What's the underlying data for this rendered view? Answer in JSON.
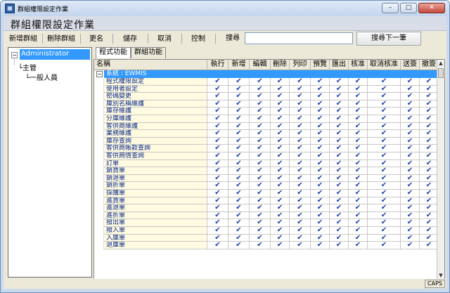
{
  "window": {
    "app_icon": "app-icon",
    "title": "群組權限設定作業",
    "buttons": {
      "minimize": "–",
      "maximize": "□",
      "close": "✕"
    }
  },
  "header": {
    "title": "群組權限設定作業"
  },
  "toolbar": {
    "new_group": "新增群組",
    "delete_group": "刪除群組",
    "rename": "更名",
    "save": "儲存",
    "cancel": "取消",
    "control": "控制",
    "search_label": "搜尋",
    "search_value": "",
    "find_next": "搜尋下一筆"
  },
  "tree": {
    "root": "Administrator",
    "root_toggle": "−",
    "children": [
      "主管",
      "一般人員"
    ]
  },
  "tabs": [
    "程式功能",
    "群組功能"
  ],
  "grid": {
    "columns": [
      "名稱",
      "執行",
      "新增",
      "編輯",
      "刪除",
      "列印",
      "預覽",
      "匯出",
      "核准",
      "取消核准",
      "送簽",
      "撤簽"
    ],
    "group_toggle": "−",
    "group_label": "系統 : EWMIS",
    "check_glyph": "✔",
    "rows": [
      "程式權限設定",
      "使用者設定",
      "密碼變更",
      "庫別名稱維護",
      "庫存維護",
      "分庫維護",
      "客供商維護",
      "業務維護",
      "庫存查詢",
      "客供商帳款查詢",
      "客供商情查詢",
      "訂單",
      "銷貨單",
      "銷退單",
      "銷折單",
      "採購單",
      "進貨單",
      "進退單",
      "進折單",
      "撥出單",
      "撥入單",
      "入庫單",
      "退庫單"
    ]
  },
  "scrollbar": {
    "up": "▲",
    "down": "▼"
  },
  "status": {
    "caps": "CAPS"
  }
}
